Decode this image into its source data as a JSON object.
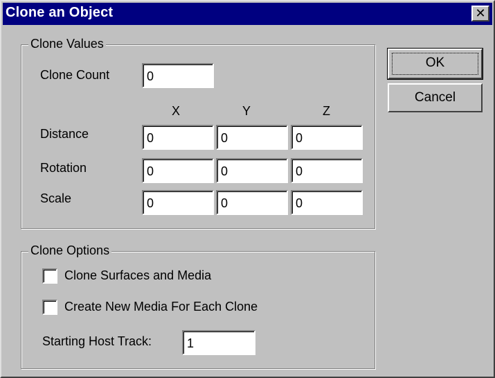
{
  "window": {
    "title": "Clone an Object",
    "close_symbol": "✕"
  },
  "clone_values": {
    "label": "Clone Values",
    "clone_count_label": "Clone Count",
    "clone_count_value": "0",
    "axes": [
      "X",
      "Y",
      "Z"
    ],
    "rows": [
      {
        "label": "Distance",
        "values": [
          "0",
          "0",
          "0"
        ]
      },
      {
        "label": "Rotation",
        "values": [
          "0",
          "0",
          "0"
        ]
      },
      {
        "label": "Scale",
        "values": [
          "0",
          "0",
          "0"
        ]
      }
    ]
  },
  "clone_options": {
    "label": "Clone Options",
    "checkboxes": [
      {
        "label": "Clone Surfaces and Media",
        "checked": false
      },
      {
        "label": "Create New Media For Each Clone",
        "checked": false
      }
    ],
    "starting_host_track_label": "Starting Host Track:",
    "starting_host_track_value": "1"
  },
  "buttons": {
    "ok": "OK",
    "cancel": "Cancel"
  },
  "icons": {
    "close": "close-icon"
  }
}
